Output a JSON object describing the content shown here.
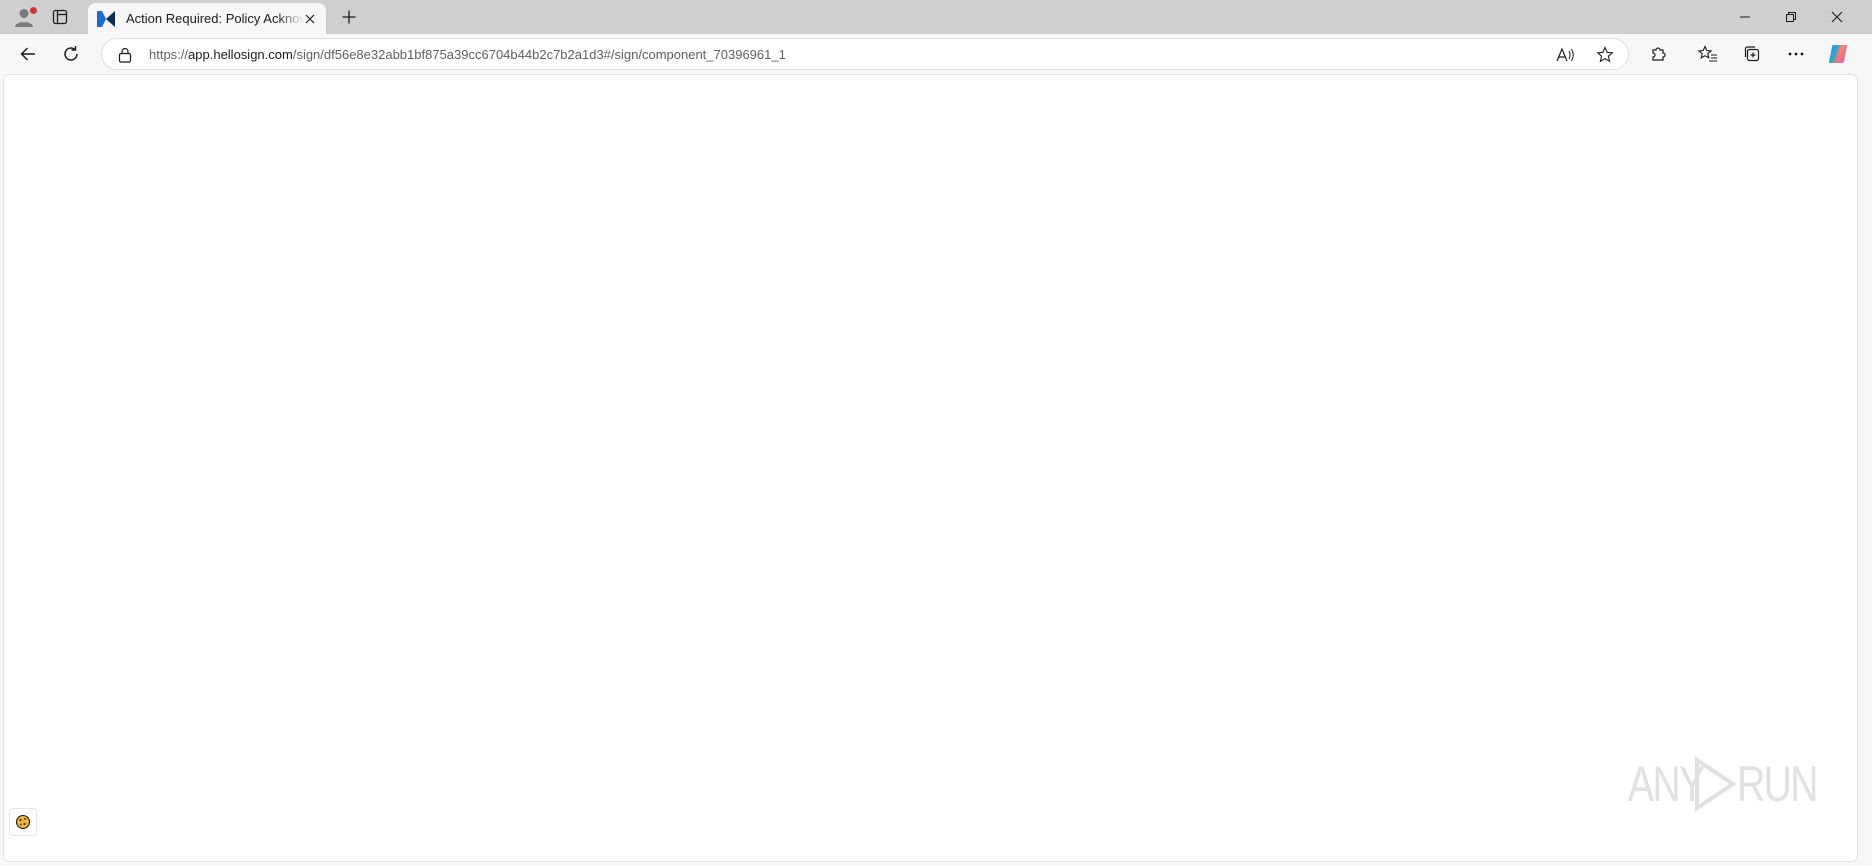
{
  "tab": {
    "title": "Action Required: Policy Acknowledgement"
  },
  "address_bar": {
    "url_scheme": "https://",
    "url_host": "app.hellosign.com",
    "url_path": "/sign/df56e8e32abb1bf875a39cc6704b44b2c7b2a1d3#/sign/component_70396961_1"
  },
  "watermark": {
    "text_left": "ANY",
    "text_right": "RUN"
  },
  "colors": {
    "tabstrip_bg": "#cfcfcf",
    "toolbar_bg": "#f7f7f7",
    "favicon_blue": "#1c6ad6",
    "favicon_dark": "#0b2d5e",
    "notification_red": "#d13438"
  },
  "icons": {
    "profile": "profile-icon",
    "tab_actions": "tab-actions-icon",
    "favicon": "hellosign-favicon",
    "close_tab": "close-icon",
    "new_tab": "plus-icon",
    "minimize": "minimize-icon",
    "restore": "restore-icon",
    "close_window": "close-icon",
    "back": "back-arrow-icon",
    "refresh": "refresh-icon",
    "lock": "lock-icon",
    "read_aloud": "read-aloud-icon",
    "favorite": "star-icon",
    "extensions": "puzzle-icon",
    "favorites": "favorites-list-icon",
    "collections": "collections-icon",
    "more": "more-icon",
    "copilot": "copilot-icon",
    "cookie": "cookie-icon"
  }
}
